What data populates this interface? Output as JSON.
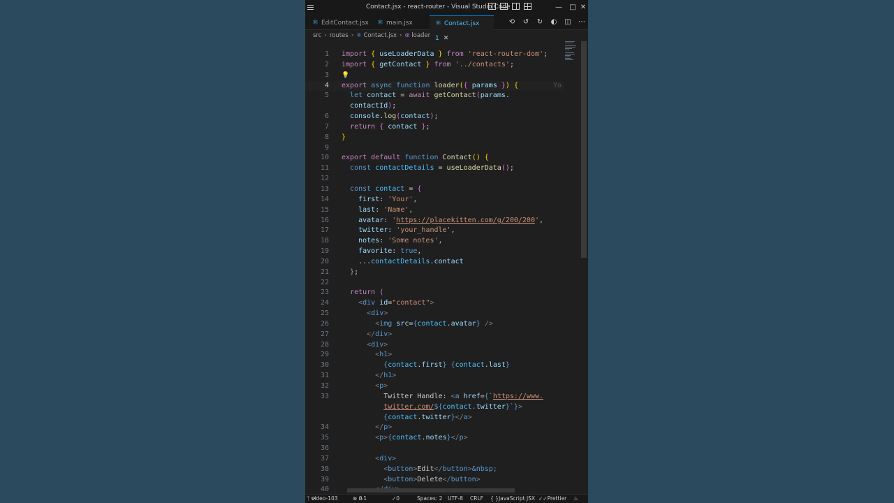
{
  "window": {
    "title": "Contact.jsx - react-router - Visual Studio Code"
  },
  "tabs": [
    {
      "label": "EditContact.jsx"
    },
    {
      "label": "main.jsx"
    },
    {
      "label": "Contact.jsx 1"
    }
  ],
  "breadcrumb": [
    "src",
    "routes",
    "Contact.jsx",
    "loader"
  ],
  "code": {
    "line_numbers": [
      "1",
      "2",
      "3",
      "4",
      "5",
      "",
      "6",
      "7",
      "8",
      "9",
      "10",
      "11",
      "12",
      "13",
      "14",
      "15",
      "16",
      "17",
      "18",
      "19",
      "20",
      "21",
      "22",
      "23",
      "24",
      "25",
      "26",
      "27",
      "28",
      "29",
      "30",
      "31",
      "32",
      "33",
      "",
      "",
      "34",
      "35",
      "36",
      "37",
      "38",
      "39",
      "40"
    ],
    "inline_hint": "Yo"
  },
  "status": {
    "branch": "video-103",
    "errors": "0",
    "warnings": "1",
    "ports": "0",
    "spaces": "Spaces: 2",
    "encoding": "UTF-8",
    "eol": "CRLF",
    "language": "JavaScript JSX",
    "formatter": "Prettier"
  },
  "icons": {
    "menu": "hamburger-icon",
    "react": "react-icon",
    "bulb": "lightbulb-icon",
    "close": "close-icon"
  },
  "colors": {
    "background": "#2b4a5e",
    "editor": "#1f1f1f",
    "accent": "#0078d4",
    "keyword": "#c586c0",
    "string": "#ce9178",
    "function": "#dcdcaa",
    "variable": "#9cdcfe"
  }
}
